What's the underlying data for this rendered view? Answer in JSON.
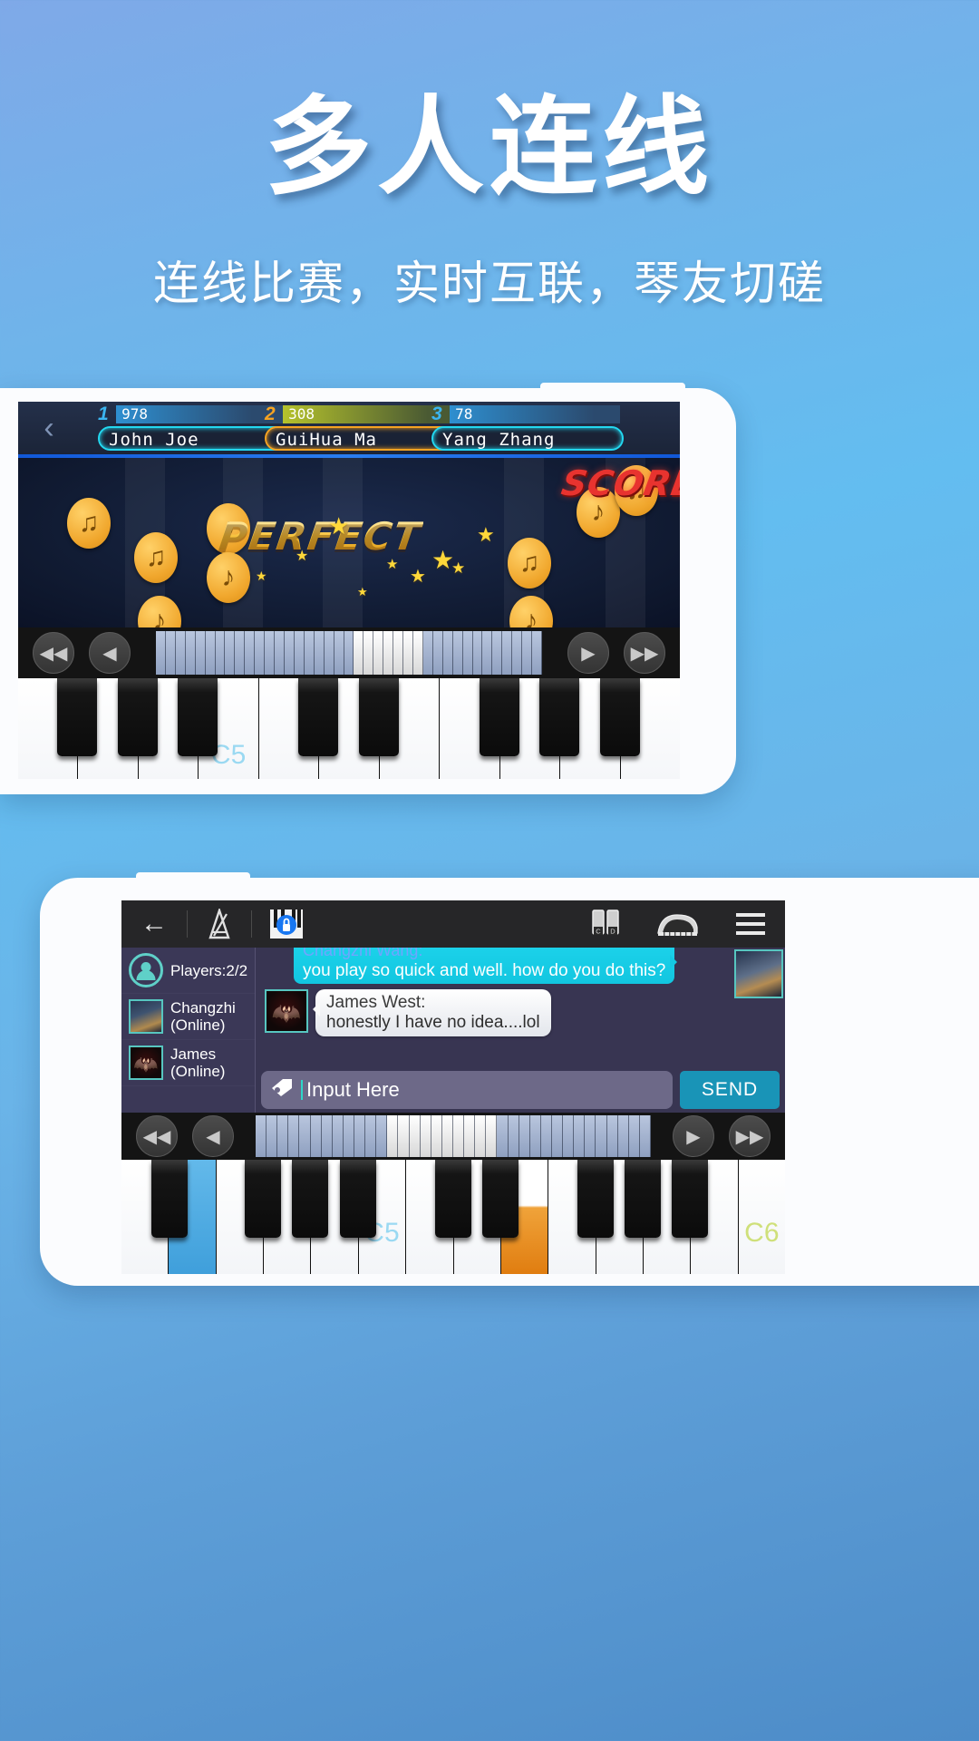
{
  "hero": {
    "title": "多人连线",
    "subtitle": "连线比赛，实时互联，琴友切磋"
  },
  "top_screen": {
    "back_icon": "‹",
    "ranks": [
      {
        "place": "1",
        "score": "978",
        "name": "John Joe",
        "color": "#23d8f0"
      },
      {
        "place": "2",
        "score": "308",
        "name": "GuiHua Ma",
        "color": "#f5a322"
      },
      {
        "place": "3",
        "score": "78",
        "name": "Yang Zhang",
        "color": "#23d8f0"
      }
    ],
    "judgement": "PERFECT",
    "score_label": "SCORE",
    "note_glyph": "♪",
    "note_glyph_double": "♫",
    "star_glyph": "★",
    "transport": {
      "rewind_fast": "◀◀",
      "rewind": "◀",
      "play": "▶",
      "forward_fast": "▶▶"
    },
    "key_label_c5": "C5"
  },
  "bottom_screen": {
    "toolbar": {
      "back_icon": "←",
      "metronome_icon": "metronome",
      "lock_icon": "piano-lock",
      "keylabels_icon": "C D",
      "piano_icon": "grand-piano",
      "menu_icon": "☰"
    },
    "players_panel": {
      "header": "Players:2/2",
      "items": [
        {
          "name": "Changzhi",
          "status": "(Online)"
        },
        {
          "name": "James",
          "status": "(Online)"
        }
      ]
    },
    "messages": [
      {
        "sender": "Changzhi Wang:",
        "text": "you play so quick and well. how do you do this?",
        "side": "right",
        "style": "cyan"
      },
      {
        "sender": "James West:",
        "text": "honestly I have no idea....lol",
        "side": "left",
        "style": "white"
      }
    ],
    "input": {
      "placeholder": "Input Here",
      "send_label": "SEND"
    },
    "transport": {
      "rewind_fast": "◀◀",
      "rewind": "◀",
      "play": "▶",
      "forward_fast": "▶▶"
    },
    "key_label_c5": "C5",
    "key_label_c6": "C6"
  },
  "colors": {
    "accent_cyan": "#23d8f0",
    "accent_orange": "#f5a322",
    "send_blue": "#1994b7",
    "chat_bg": "#383552",
    "key_label_blue": "#9ad9f2",
    "key_label_green": "#cfe07a"
  }
}
